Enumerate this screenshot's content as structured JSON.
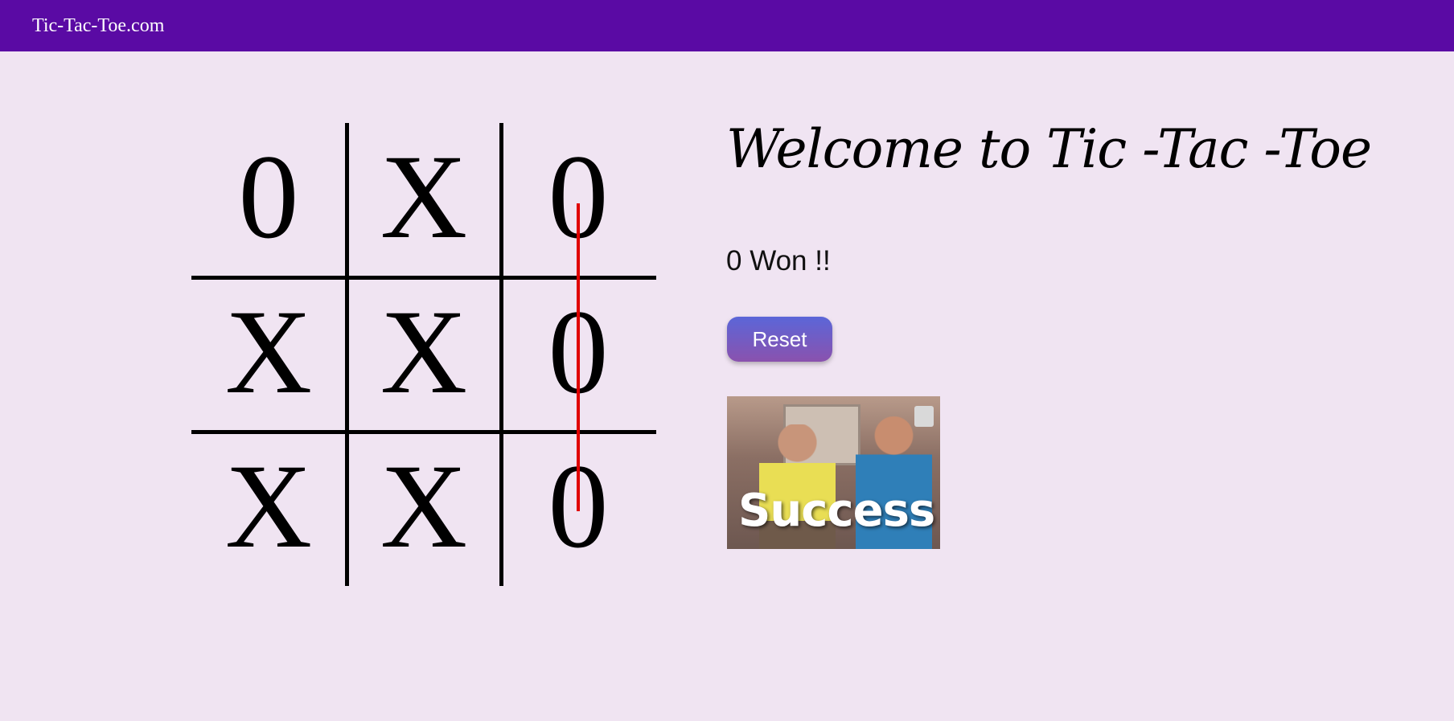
{
  "navbar": {
    "brand": "Tic-Tac-Toe.com",
    "background": "#5a0aa4"
  },
  "game": {
    "board": [
      [
        "0",
        "X",
        "0"
      ],
      [
        "X",
        "X",
        "0"
      ],
      [
        "X",
        "X",
        "0"
      ]
    ],
    "winning_line": "column-3",
    "winning_line_color": "#e00000"
  },
  "panel": {
    "heading": "Welcome to Tic -Tac -Toe",
    "status": "0 Won !!",
    "reset_label": "Reset",
    "gif_caption": "Success!"
  }
}
